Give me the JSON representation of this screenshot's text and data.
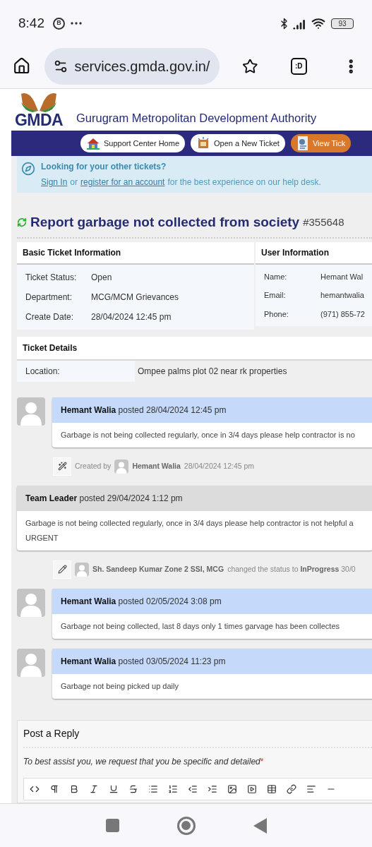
{
  "status_bar": {
    "time": "8:42",
    "notification_letter": "B",
    "battery": "93"
  },
  "browser": {
    "url": "services.gmda.gov.in/",
    "tab_label": ":D"
  },
  "site": {
    "logo_text": "GMDA",
    "title": "Gurugram Metropolitan Development Authority",
    "nav": [
      {
        "label": "Support Center Home",
        "kind": "home"
      },
      {
        "label": "Open a New Ticket",
        "kind": "new"
      },
      {
        "label": "View Tick",
        "kind": "view"
      }
    ]
  },
  "notice": {
    "title": "Looking for your other tickets?",
    "sign_in": "Sign In",
    "or": "or",
    "register": "register for an account",
    "rest": "for the best experience on our help desk."
  },
  "ticket": {
    "subject": "Report garbage not collected from society",
    "number": "#355648"
  },
  "basic_info": {
    "heading": "Basic Ticket Information",
    "rows": [
      {
        "label": "Ticket Status:",
        "value": "Open"
      },
      {
        "label": "Department:",
        "value": "MCG/MCM Grievances"
      },
      {
        "label": "Create Date:",
        "value": "28/04/2024 12:45 pm"
      }
    ]
  },
  "user_info": {
    "heading": "User Information",
    "rows": [
      {
        "label": "Name:",
        "value": "Hemant Wal"
      },
      {
        "label": "Email:",
        "value": "hemantwalia"
      },
      {
        "label": "Phone:",
        "value": "(971) 855-72"
      }
    ]
  },
  "details": {
    "heading": "Ticket Details",
    "rows": [
      {
        "label": "Location:",
        "value": "Ompee palms plot 02 near rk properties"
      }
    ]
  },
  "thread": [
    {
      "kind": "user_post",
      "author": "Hemant Walia",
      "posted": "posted 28/04/2024 12:45 pm",
      "body_lines": [
        "Garbage is not being collected regularly, once in 3/4 days please help contractor is no"
      ]
    },
    {
      "kind": "created_event",
      "before": "Created by",
      "author": "Hemant Walia",
      "after": "28/04/2024 12:45 pm"
    },
    {
      "kind": "staff_post",
      "author": "Team Leader",
      "posted": "posted 29/04/2024 1:12 pm",
      "body_lines": [
        "Garbage is not being collected regularly, once in 3/4 days please help contractor is not helpful a",
        "URGENT"
      ]
    },
    {
      "kind": "status_event",
      "author": "Sh. Sandeep Kumar Zone 2 SSI, MCG",
      "after": "changed the status to **InProgress** 30/0"
    },
    {
      "kind": "user_post",
      "author": "Hemant Walia",
      "posted": "posted 02/05/2024 3:08 pm",
      "body_lines": [
        "Garbage not being collected, last 8 days only 1 times garvage has been collectes"
      ]
    },
    {
      "kind": "user_post",
      "author": "Hemant Walia",
      "posted": "posted 03/05/2024 11:23 pm",
      "body_lines": [
        "Garbage not being picked up daily"
      ]
    }
  ],
  "reply": {
    "heading": "Post a Reply",
    "prompt": "To best assist you, we request that you be specific and detailed",
    "required_mark": "*"
  }
}
